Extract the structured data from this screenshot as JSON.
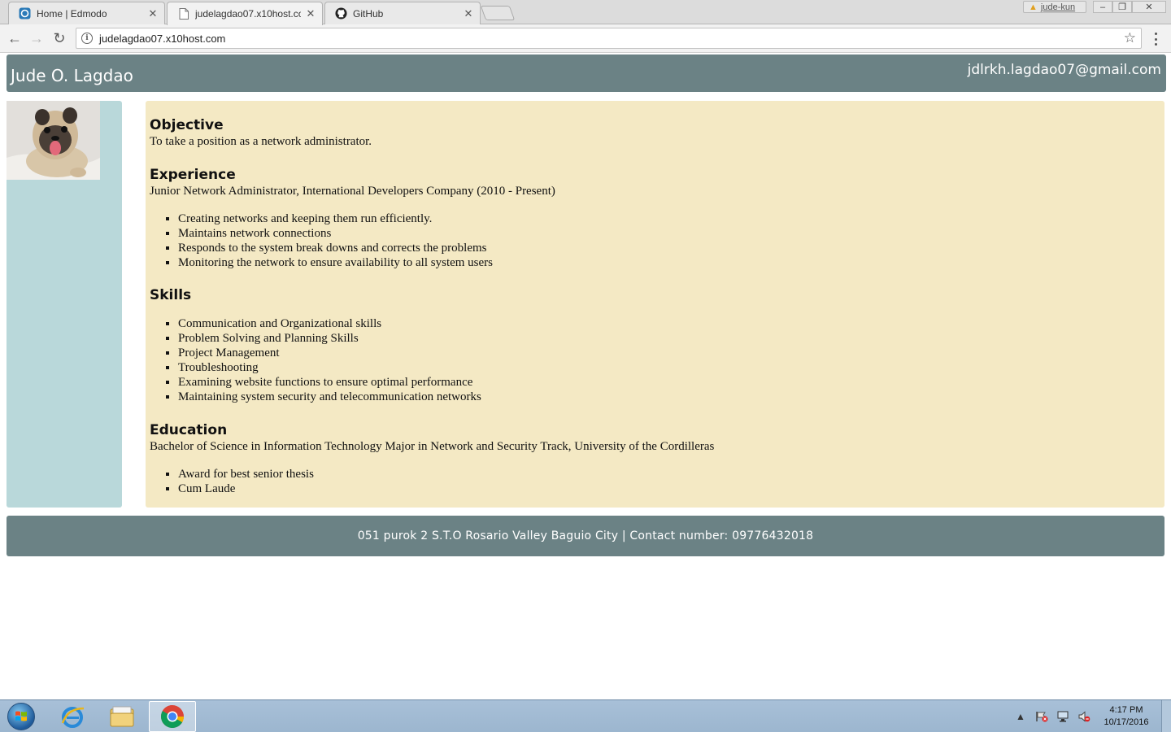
{
  "browser": {
    "tabs": [
      {
        "title": "Home | Edmodo",
        "close": "✕"
      },
      {
        "title": "judelagdao07.x10host.co",
        "close": "✕"
      },
      {
        "title": "GitHub",
        "close": "✕"
      }
    ],
    "profile_name": "jude-kun",
    "url": "judelagdao07.x10host.com"
  },
  "page": {
    "header": {
      "name": "Jude O. Lagdao",
      "email": "jdlrkh.lagdao07@gmail.com"
    },
    "objective": {
      "heading": "Objective",
      "text": "To take a position as a network administrator."
    },
    "experience": {
      "heading": "Experience",
      "text": "Junior Network Administrator, International Developers Company (2010 - Present)",
      "items": [
        "Creating networks and keeping them run efficiently.",
        "Maintains network connections",
        "Responds to the system break downs and corrects the problems",
        "Monitoring the network to ensure availability to all system users"
      ]
    },
    "skills": {
      "heading": "Skills",
      "items": [
        "Communication and Organizational skills",
        "Problem Solving and Planning Skills",
        "Project Management",
        "Troubleshooting",
        "Examining website functions to ensure optimal performance",
        "Maintaining system security and telecommunication networks"
      ]
    },
    "education": {
      "heading": "Education",
      "text": "Bachelor of Science in Information Technology Major in Network and Security Track, University of the Cordilleras",
      "items": [
        "Award for best senior thesis",
        "Cum Laude"
      ]
    },
    "footer": "051 purok 2 S.T.O Rosario Valley Baguio City | Contact number: 09776432018"
  },
  "taskbar": {
    "time": "4:17 PM",
    "date": "10/17/2016"
  },
  "colors": {
    "header_bg": "#6b8285",
    "sidebar_bg": "#b9d8da",
    "main_bg": "#f4e9c4"
  }
}
